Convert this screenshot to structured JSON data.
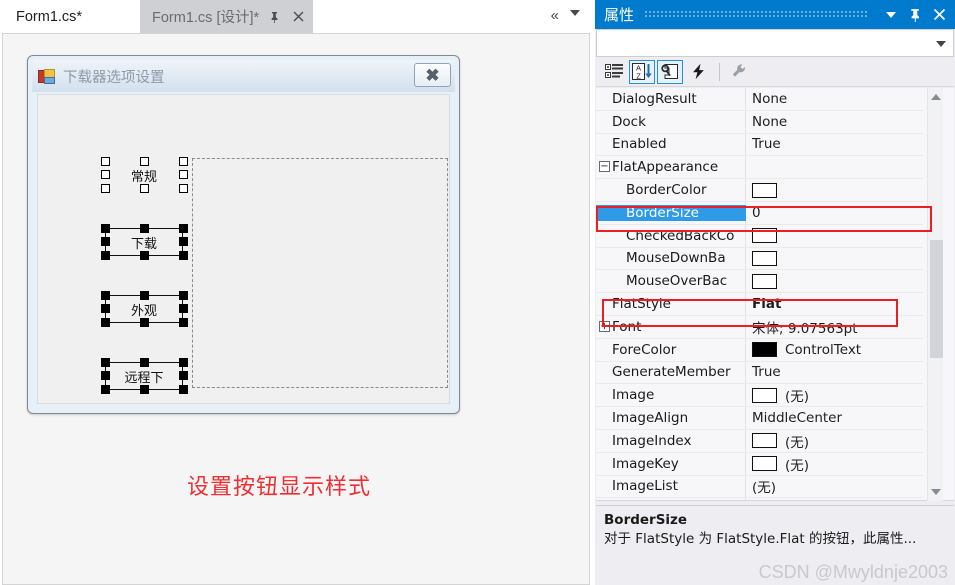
{
  "editor": {
    "tabs": [
      {
        "label": "Form1.cs*",
        "active": false
      },
      {
        "label": "Form1.cs [设计]*",
        "active": true
      }
    ],
    "tab_pin_icon": "pin-icon",
    "tab_close_icon": "close-icon",
    "overflow_label": "«",
    "dropdown_icon": "chevron-down-icon"
  },
  "form_designer": {
    "window_title": "下载器选项设置",
    "window_icon": "app-icon",
    "close_button_glyph": "✖",
    "buttons": [
      {
        "label": "常规",
        "selection": "hollow"
      },
      {
        "label": "下载",
        "selection": "filled"
      },
      {
        "label": "外观",
        "selection": "filled"
      },
      {
        "label": "远程下",
        "selection": "filled"
      }
    ],
    "placeholder_panel": "",
    "caption": "设置按钮显示样式",
    "caption_color": "#ef2f34"
  },
  "properties_panel": {
    "title": "属性",
    "header_caret_icon": "chevron-down-icon",
    "header_pin_icon": "pin-icon",
    "header_close_icon": "close-icon",
    "object_selector_value": "",
    "object_selector_caret": "chevron-down-icon",
    "toolbar": [
      {
        "name": "categorized-icon",
        "pressed": false
      },
      {
        "name": "alphabetical-sort-icon",
        "pressed": true
      },
      {
        "name": "properties-icon",
        "pressed": true
      },
      {
        "name": "events-lightning-icon",
        "pressed": false
      },
      {
        "name": "wrench-icon",
        "pressed": false
      }
    ],
    "selected_property": "BorderSize",
    "accent_color": "#007acc",
    "selection_color": "#2f9ae8",
    "highlight_color": "#e81f23",
    "rows": [
      {
        "name": "DialogResult",
        "value": "None",
        "indent": false,
        "expander": "",
        "swatch": "",
        "selected": false,
        "bold": false
      },
      {
        "name": "Dock",
        "value": "None",
        "indent": false,
        "expander": "",
        "swatch": "",
        "selected": false,
        "bold": false
      },
      {
        "name": "Enabled",
        "value": "True",
        "indent": false,
        "expander": "",
        "swatch": "",
        "selected": false,
        "bold": false
      },
      {
        "name": "FlatAppearance",
        "value": "",
        "indent": false,
        "expander": "-",
        "swatch": "",
        "selected": false,
        "bold": false
      },
      {
        "name": "BorderColor",
        "value": "",
        "indent": true,
        "expander": "",
        "swatch": "white",
        "selected": false,
        "bold": false
      },
      {
        "name": "BorderSize",
        "value": "0",
        "indent": true,
        "expander": "",
        "swatch": "",
        "selected": true,
        "bold": false
      },
      {
        "name": "CheckedBackCo",
        "value": "",
        "indent": true,
        "expander": "",
        "swatch": "white",
        "selected": false,
        "bold": false
      },
      {
        "name": "MouseDownBa",
        "value": "",
        "indent": true,
        "expander": "",
        "swatch": "white",
        "selected": false,
        "bold": false
      },
      {
        "name": "MouseOverBac",
        "value": "",
        "indent": true,
        "expander": "",
        "swatch": "white",
        "selected": false,
        "bold": false
      },
      {
        "name": "FlatStyle",
        "value": "Flat",
        "indent": false,
        "expander": "",
        "swatch": "",
        "selected": false,
        "bold": true
      },
      {
        "name": "Font",
        "value": "宋体; 9.07563pt",
        "indent": false,
        "expander": "+",
        "swatch": "",
        "selected": false,
        "bold": false
      },
      {
        "name": "ForeColor",
        "value": "ControlText",
        "indent": false,
        "expander": "",
        "swatch": "black",
        "selected": false,
        "bold": false
      },
      {
        "name": "GenerateMember",
        "value": "True",
        "indent": false,
        "expander": "",
        "swatch": "",
        "selected": false,
        "bold": false
      },
      {
        "name": "Image",
        "value": "(无)",
        "indent": false,
        "expander": "",
        "swatch": "white",
        "selected": false,
        "bold": false
      },
      {
        "name": "ImageAlign",
        "value": "MiddleCenter",
        "indent": false,
        "expander": "",
        "swatch": "",
        "selected": false,
        "bold": false
      },
      {
        "name": "ImageIndex",
        "value": "(无)",
        "indent": false,
        "expander": "",
        "swatch": "white",
        "selected": false,
        "bold": false
      },
      {
        "name": "ImageKey",
        "value": "(无)",
        "indent": false,
        "expander": "",
        "swatch": "white",
        "selected": false,
        "bold": false
      },
      {
        "name": "ImageList",
        "value": "(无)",
        "indent": false,
        "expander": "",
        "swatch": "",
        "selected": false,
        "bold": false
      }
    ],
    "description": {
      "title": "BorderSize",
      "body": "对于 FlatStyle 为 FlatStyle.Flat 的按钮，此属性..."
    },
    "scrollbar": {
      "up_icon": "scroll-up-arrow-icon",
      "down_icon": "scroll-down-arrow-icon"
    }
  },
  "watermark": "CSDN @Mwyldnje2003"
}
